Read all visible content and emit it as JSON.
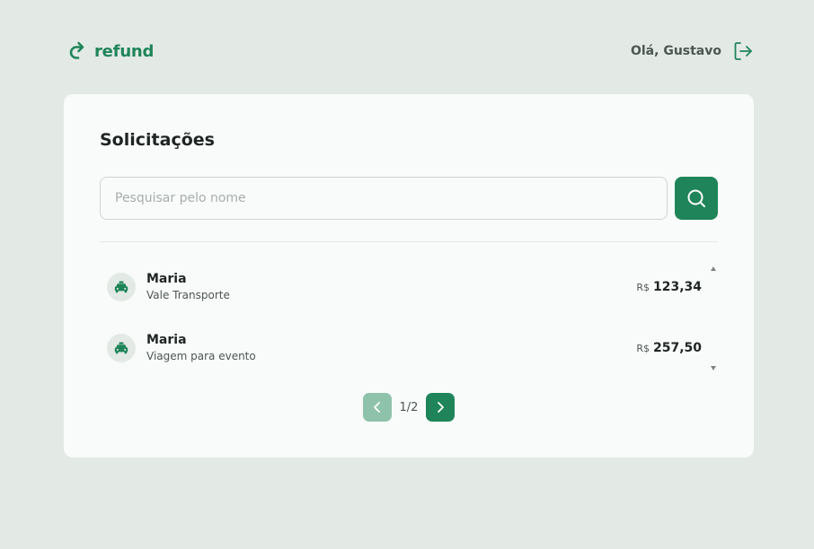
{
  "header": {
    "logo_text": "refund",
    "greeting": "Olá, Gustavo"
  },
  "card": {
    "title": "Solicitações",
    "search": {
      "placeholder": "Pesquisar pelo nome",
      "value": ""
    },
    "items": [
      {
        "name": "Maria",
        "category": "Vale Transporte",
        "currency": "R$",
        "amount": "123,34",
        "icon": "car-icon"
      },
      {
        "name": "Maria",
        "category": "Viagem para evento",
        "currency": "R$",
        "amount": "257,50",
        "icon": "car-icon"
      }
    ],
    "pagination": {
      "label": "1/2"
    }
  },
  "colors": {
    "brand": "#1f8459",
    "brand_light": "#8fc2ab",
    "background": "#e3eae6",
    "card": "#f9fbfa"
  }
}
